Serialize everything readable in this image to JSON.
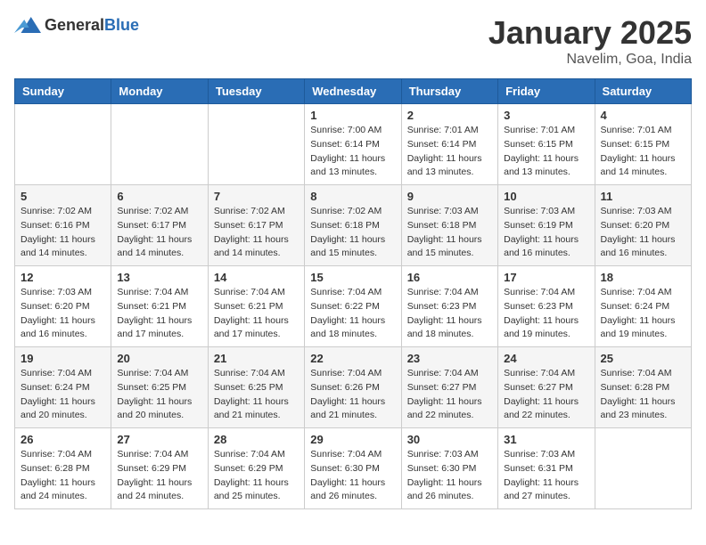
{
  "header": {
    "logo_general": "General",
    "logo_blue": "Blue",
    "title": "January 2025",
    "location": "Navelim, Goa, India"
  },
  "weekdays": [
    "Sunday",
    "Monday",
    "Tuesday",
    "Wednesday",
    "Thursday",
    "Friday",
    "Saturday"
  ],
  "weeks": [
    [
      {
        "day": "",
        "sunrise": "",
        "sunset": "",
        "daylight": ""
      },
      {
        "day": "",
        "sunrise": "",
        "sunset": "",
        "daylight": ""
      },
      {
        "day": "",
        "sunrise": "",
        "sunset": "",
        "daylight": ""
      },
      {
        "day": "1",
        "sunrise": "Sunrise: 7:00 AM",
        "sunset": "Sunset: 6:14 PM",
        "daylight": "Daylight: 11 hours and 13 minutes."
      },
      {
        "day": "2",
        "sunrise": "Sunrise: 7:01 AM",
        "sunset": "Sunset: 6:14 PM",
        "daylight": "Daylight: 11 hours and 13 minutes."
      },
      {
        "day": "3",
        "sunrise": "Sunrise: 7:01 AM",
        "sunset": "Sunset: 6:15 PM",
        "daylight": "Daylight: 11 hours and 13 minutes."
      },
      {
        "day": "4",
        "sunrise": "Sunrise: 7:01 AM",
        "sunset": "Sunset: 6:15 PM",
        "daylight": "Daylight: 11 hours and 14 minutes."
      }
    ],
    [
      {
        "day": "5",
        "sunrise": "Sunrise: 7:02 AM",
        "sunset": "Sunset: 6:16 PM",
        "daylight": "Daylight: 11 hours and 14 minutes."
      },
      {
        "day": "6",
        "sunrise": "Sunrise: 7:02 AM",
        "sunset": "Sunset: 6:17 PM",
        "daylight": "Daylight: 11 hours and 14 minutes."
      },
      {
        "day": "7",
        "sunrise": "Sunrise: 7:02 AM",
        "sunset": "Sunset: 6:17 PM",
        "daylight": "Daylight: 11 hours and 14 minutes."
      },
      {
        "day": "8",
        "sunrise": "Sunrise: 7:02 AM",
        "sunset": "Sunset: 6:18 PM",
        "daylight": "Daylight: 11 hours and 15 minutes."
      },
      {
        "day": "9",
        "sunrise": "Sunrise: 7:03 AM",
        "sunset": "Sunset: 6:18 PM",
        "daylight": "Daylight: 11 hours and 15 minutes."
      },
      {
        "day": "10",
        "sunrise": "Sunrise: 7:03 AM",
        "sunset": "Sunset: 6:19 PM",
        "daylight": "Daylight: 11 hours and 16 minutes."
      },
      {
        "day": "11",
        "sunrise": "Sunrise: 7:03 AM",
        "sunset": "Sunset: 6:20 PM",
        "daylight": "Daylight: 11 hours and 16 minutes."
      }
    ],
    [
      {
        "day": "12",
        "sunrise": "Sunrise: 7:03 AM",
        "sunset": "Sunset: 6:20 PM",
        "daylight": "Daylight: 11 hours and 16 minutes."
      },
      {
        "day": "13",
        "sunrise": "Sunrise: 7:04 AM",
        "sunset": "Sunset: 6:21 PM",
        "daylight": "Daylight: 11 hours and 17 minutes."
      },
      {
        "day": "14",
        "sunrise": "Sunrise: 7:04 AM",
        "sunset": "Sunset: 6:21 PM",
        "daylight": "Daylight: 11 hours and 17 minutes."
      },
      {
        "day": "15",
        "sunrise": "Sunrise: 7:04 AM",
        "sunset": "Sunset: 6:22 PM",
        "daylight": "Daylight: 11 hours and 18 minutes."
      },
      {
        "day": "16",
        "sunrise": "Sunrise: 7:04 AM",
        "sunset": "Sunset: 6:23 PM",
        "daylight": "Daylight: 11 hours and 18 minutes."
      },
      {
        "day": "17",
        "sunrise": "Sunrise: 7:04 AM",
        "sunset": "Sunset: 6:23 PM",
        "daylight": "Daylight: 11 hours and 19 minutes."
      },
      {
        "day": "18",
        "sunrise": "Sunrise: 7:04 AM",
        "sunset": "Sunset: 6:24 PM",
        "daylight": "Daylight: 11 hours and 19 minutes."
      }
    ],
    [
      {
        "day": "19",
        "sunrise": "Sunrise: 7:04 AM",
        "sunset": "Sunset: 6:24 PM",
        "daylight": "Daylight: 11 hours and 20 minutes."
      },
      {
        "day": "20",
        "sunrise": "Sunrise: 7:04 AM",
        "sunset": "Sunset: 6:25 PM",
        "daylight": "Daylight: 11 hours and 20 minutes."
      },
      {
        "day": "21",
        "sunrise": "Sunrise: 7:04 AM",
        "sunset": "Sunset: 6:25 PM",
        "daylight": "Daylight: 11 hours and 21 minutes."
      },
      {
        "day": "22",
        "sunrise": "Sunrise: 7:04 AM",
        "sunset": "Sunset: 6:26 PM",
        "daylight": "Daylight: 11 hours and 21 minutes."
      },
      {
        "day": "23",
        "sunrise": "Sunrise: 7:04 AM",
        "sunset": "Sunset: 6:27 PM",
        "daylight": "Daylight: 11 hours and 22 minutes."
      },
      {
        "day": "24",
        "sunrise": "Sunrise: 7:04 AM",
        "sunset": "Sunset: 6:27 PM",
        "daylight": "Daylight: 11 hours and 22 minutes."
      },
      {
        "day": "25",
        "sunrise": "Sunrise: 7:04 AM",
        "sunset": "Sunset: 6:28 PM",
        "daylight": "Daylight: 11 hours and 23 minutes."
      }
    ],
    [
      {
        "day": "26",
        "sunrise": "Sunrise: 7:04 AM",
        "sunset": "Sunset: 6:28 PM",
        "daylight": "Daylight: 11 hours and 24 minutes."
      },
      {
        "day": "27",
        "sunrise": "Sunrise: 7:04 AM",
        "sunset": "Sunset: 6:29 PM",
        "daylight": "Daylight: 11 hours and 24 minutes."
      },
      {
        "day": "28",
        "sunrise": "Sunrise: 7:04 AM",
        "sunset": "Sunset: 6:29 PM",
        "daylight": "Daylight: 11 hours and 25 minutes."
      },
      {
        "day": "29",
        "sunrise": "Sunrise: 7:04 AM",
        "sunset": "Sunset: 6:30 PM",
        "daylight": "Daylight: 11 hours and 26 minutes."
      },
      {
        "day": "30",
        "sunrise": "Sunrise: 7:03 AM",
        "sunset": "Sunset: 6:30 PM",
        "daylight": "Daylight: 11 hours and 26 minutes."
      },
      {
        "day": "31",
        "sunrise": "Sunrise: 7:03 AM",
        "sunset": "Sunset: 6:31 PM",
        "daylight": "Daylight: 11 hours and 27 minutes."
      },
      {
        "day": "",
        "sunrise": "",
        "sunset": "",
        "daylight": ""
      }
    ]
  ]
}
